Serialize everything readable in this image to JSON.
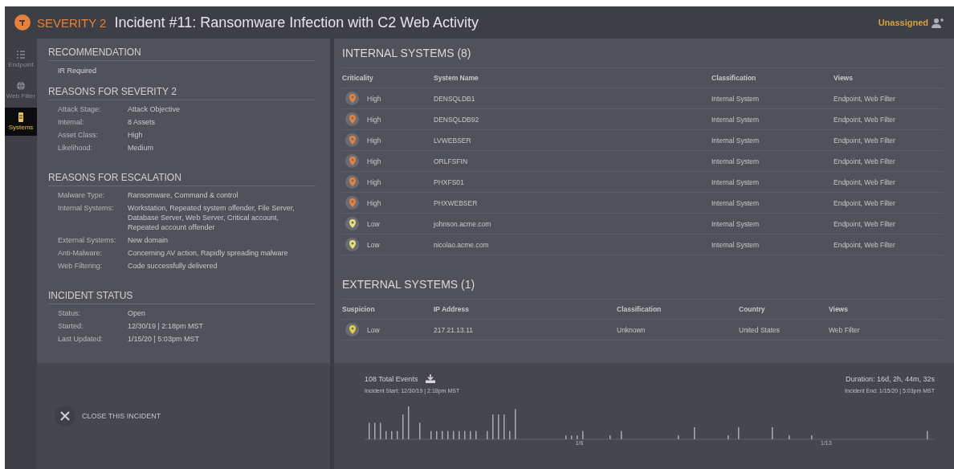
{
  "header": {
    "severity": "SEVERITY 2",
    "title": "Incident #11: Ransomware Infection with C2 Web Activity",
    "assignee": "Unassigned"
  },
  "sidebar": {
    "items": [
      {
        "label": "Endpoint",
        "kind": "list",
        "selected": false
      },
      {
        "label": "Web Filter",
        "kind": "globe",
        "selected": false
      },
      {
        "label": "Systems",
        "kind": "server",
        "selected": true
      }
    ]
  },
  "details": {
    "sections": [
      {
        "title": "RECOMMENDATION",
        "text": "IR Required"
      },
      {
        "title": "REASONS FOR SEVERITY 2",
        "fields": [
          {
            "label": "Attack Stage:",
            "value": "Attack Objective"
          },
          {
            "label": "Internal:",
            "value": "8 Assets"
          },
          {
            "label": "Asset Class:",
            "value": "High"
          },
          {
            "label": "Likelihood:",
            "value": "Medium"
          }
        ]
      },
      {
        "title": "REASONS FOR ESCALATION",
        "fields": [
          {
            "label": "Malware Type:",
            "value": "Ransomware, Command & control"
          },
          {
            "label": "Internal Systems:",
            "value": "Workstation, Repeated system offender, File Server, Database Server, Web Server, Critical account, Repeated account offender"
          },
          {
            "label": "External Systems:",
            "value": "New domain"
          },
          {
            "label": "Anti-Malware:",
            "value": "Concerning AV action, Rapidly spreading malware"
          },
          {
            "label": "Web Filtering:",
            "value": "Code successfully delivered"
          }
        ]
      },
      {
        "title": "INCIDENT STATUS",
        "fields": [
          {
            "label": "Status:",
            "value": "Open"
          },
          {
            "label": "Started:",
            "value": "12/30/19 | 2:18pm MST"
          },
          {
            "label": "Last Updated:",
            "value": "1/15/20 | 5:03pm MST"
          }
        ]
      }
    ],
    "close_button": "CLOSE THIS INCIDENT"
  },
  "internal_systems": {
    "title": "INTERNAL SYSTEMS (8)",
    "columns": [
      "Criticality",
      "System Name",
      "Classification",
      "Views"
    ],
    "rows": [
      {
        "criticality": "High",
        "color": "#e8823a",
        "name": "DENSQLDB1",
        "classification": "Internal System",
        "views": "Endpoint, Web Filter"
      },
      {
        "criticality": "High",
        "color": "#e8823a",
        "name": "DENSQLDB92",
        "classification": "Internal System",
        "views": "Endpoint, Web Filter"
      },
      {
        "criticality": "High",
        "color": "#e8823a",
        "name": "LVWEBSER",
        "classification": "Internal System",
        "views": "Endpoint, Web Filter"
      },
      {
        "criticality": "High",
        "color": "#e8823a",
        "name": "ORLFSFIN",
        "classification": "Internal System",
        "views": "Endpoint, Web Filter"
      },
      {
        "criticality": "High",
        "color": "#e8823a",
        "name": "PHXFS01",
        "classification": "Internal System",
        "views": "Endpoint, Web Filter"
      },
      {
        "criticality": "High",
        "color": "#e8823a",
        "name": "PHXWEBSER",
        "classification": "Internal System",
        "views": "Endpoint, Web Filter"
      },
      {
        "criticality": "Low",
        "color": "#e6e07a",
        "name": "johnson.acme.com",
        "classification": "Internal System",
        "views": "Endpoint, Web Filter"
      },
      {
        "criticality": "Low",
        "color": "#e6e07a",
        "name": "nicolao.acme.com",
        "classification": "Internal System",
        "views": "Endpoint, Web Filter"
      }
    ]
  },
  "external_systems": {
    "title": "EXTERNAL SYSTEMS (1)",
    "columns": [
      "Suspicion",
      "IP Address",
      "Classification",
      "Country",
      "Views"
    ],
    "rows": [
      {
        "suspicion": "Low",
        "color": "#e6d040",
        "ip": "217.21.13.11",
        "classification": "Unknown",
        "country": "United States",
        "views": "Web Filter"
      }
    ]
  },
  "events": {
    "total": "108 Total Events",
    "start": "Incident Start: 12/30/19 | 2:18pm MST",
    "duration": "Duration: 16d, 2h, 44m, 32s",
    "end": "Incident End: 1/15/20 | 5:03pm MST",
    "axis_labels": [
      "1/6",
      "1/13"
    ]
  }
}
